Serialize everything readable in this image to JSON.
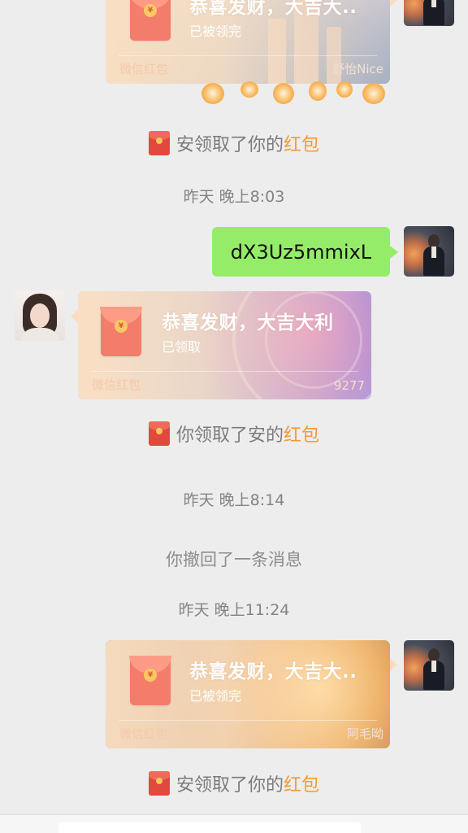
{
  "packet1": {
    "title": "恭喜发财，大吉大..",
    "status": "已被领完",
    "footer": "微信红包",
    "sender": "舒怡Nice",
    "seal": "¥"
  },
  "notice1": {
    "prefix": "安领取了你的",
    "highlight": "红包"
  },
  "time1": "昨天 晚上8:03",
  "message": {
    "text": "dX3Uz5mmixL"
  },
  "packet2": {
    "title": "恭喜发财，大吉大利",
    "status": "已领取",
    "footer": "微信红包",
    "sender": "9277",
    "seal": "¥"
  },
  "notice2": {
    "prefix": "你领取了安的",
    "highlight": "红包"
  },
  "time2": "昨天 晚上8:14",
  "recall": "你撤回了一条消息",
  "time3": "昨天 晚上11:24",
  "packet3": {
    "title": "恭喜发财，大吉大..",
    "status": "已被领完",
    "footer": "微信红包",
    "sender": "阿毛呦",
    "seal": "¥"
  },
  "notice3": {
    "prefix": "安领取了你的",
    "highlight": "红包"
  },
  "colors": {
    "bubble": "#95ec69",
    "highlight": "#f19a38",
    "background": "#ededed",
    "packet_tint": "#fce1c3"
  }
}
